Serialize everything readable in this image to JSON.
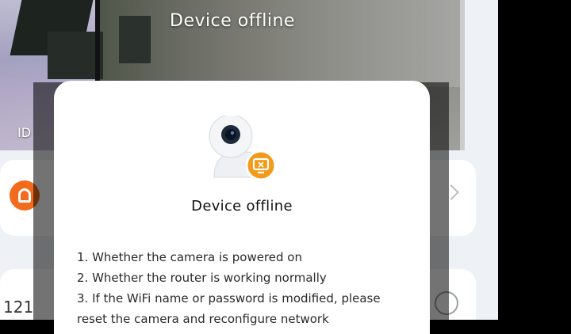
{
  "video": {
    "status_text": "Device offline",
    "id_label": "ID"
  },
  "dialog": {
    "title": "Device offline",
    "tips": [
      "1. Whether the camera is powered on",
      "2. Whether the router is working normally",
      "3. If the WiFi name or password is modified, please",
      "reset the camera and reconfigure network"
    ]
  },
  "background": {
    "partial_number": "121"
  },
  "colors": {
    "accent_orange": "#f26a1b",
    "badge_orange": "#f39a1a"
  },
  "icons": {
    "camera": "camera-icon",
    "offline_badge": "offline-badge-icon",
    "chevron": "chevron-right-icon"
  }
}
